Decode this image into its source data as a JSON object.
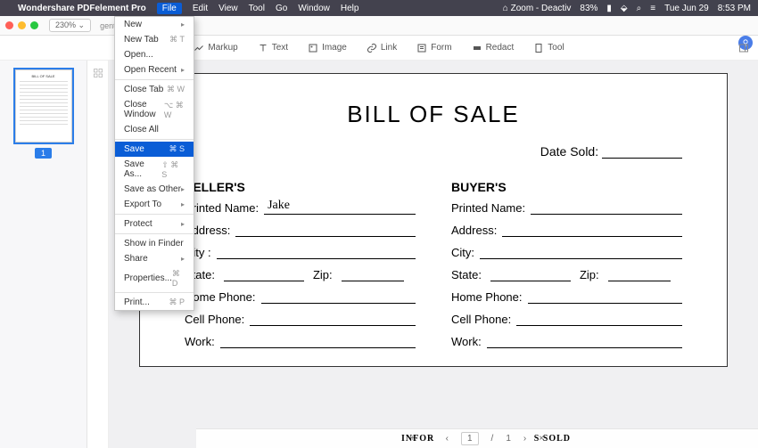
{
  "menubar": {
    "app": "Wondershare PDFelement Pro",
    "items": [
      "File",
      "Edit",
      "View",
      "Tool",
      "Go",
      "Window",
      "Help"
    ],
    "active": "File",
    "right": {
      "cloud": "⌂ Zoom - Deactiv",
      "battery": "83%",
      "day": "Tue Jun 29",
      "time": "8:53 PM"
    }
  },
  "toolbar1": {
    "zoom": "230% ⌄",
    "filename_prefix": "gent"
  },
  "toolbar2": {
    "markup": "Markup",
    "text": "Text",
    "image": "Image",
    "link": "Link",
    "form": "Form",
    "redact": "Redact",
    "tool": "Tool"
  },
  "sidebar": {
    "page_number": "1"
  },
  "dropdown": {
    "new": "New",
    "newtab": "New Tab",
    "newtab_sc": "⌘ T",
    "open": "Open...",
    "openrecent": "Open Recent",
    "closetab": "Close Tab",
    "closetab_sc": "⌘ W",
    "closewin": "Close Window",
    "closewin_sc": "⌥ ⌘ W",
    "closeall": "Close All",
    "save": "Save",
    "save_sc": "⌘ S",
    "saveas": "Save As...",
    "saveas_sc": "⇧ ⌘ S",
    "saveother": "Save as Other",
    "export": "Export To",
    "protect": "Protect",
    "showfinder": "Show in Finder",
    "share": "Share",
    "properties": "Properties...",
    "properties_sc": "⌘ D",
    "print": "Print...",
    "print_sc": "⌘ P"
  },
  "doc": {
    "title": "BILL OF SALE",
    "date_sold_label": "Date Sold:",
    "seller_header": "SELLER'S",
    "buyer_header": "BUYER'S",
    "printed_name": "Printed Name:",
    "seller_name_value": "Jake",
    "address": "Address:",
    "city": "City :",
    "city2": "City:",
    "state": "State:",
    "zip": "Zip:",
    "home_phone": "Home Phone:",
    "cell_phone": "Cell Phone:",
    "work": "Work:",
    "section": "INFOR",
    "section2": "S SOLD"
  },
  "status": {
    "page": "1",
    "total": "1",
    "plus": "+",
    "minus": "−",
    "prev": "‹",
    "next": "›",
    "close": "×"
  }
}
